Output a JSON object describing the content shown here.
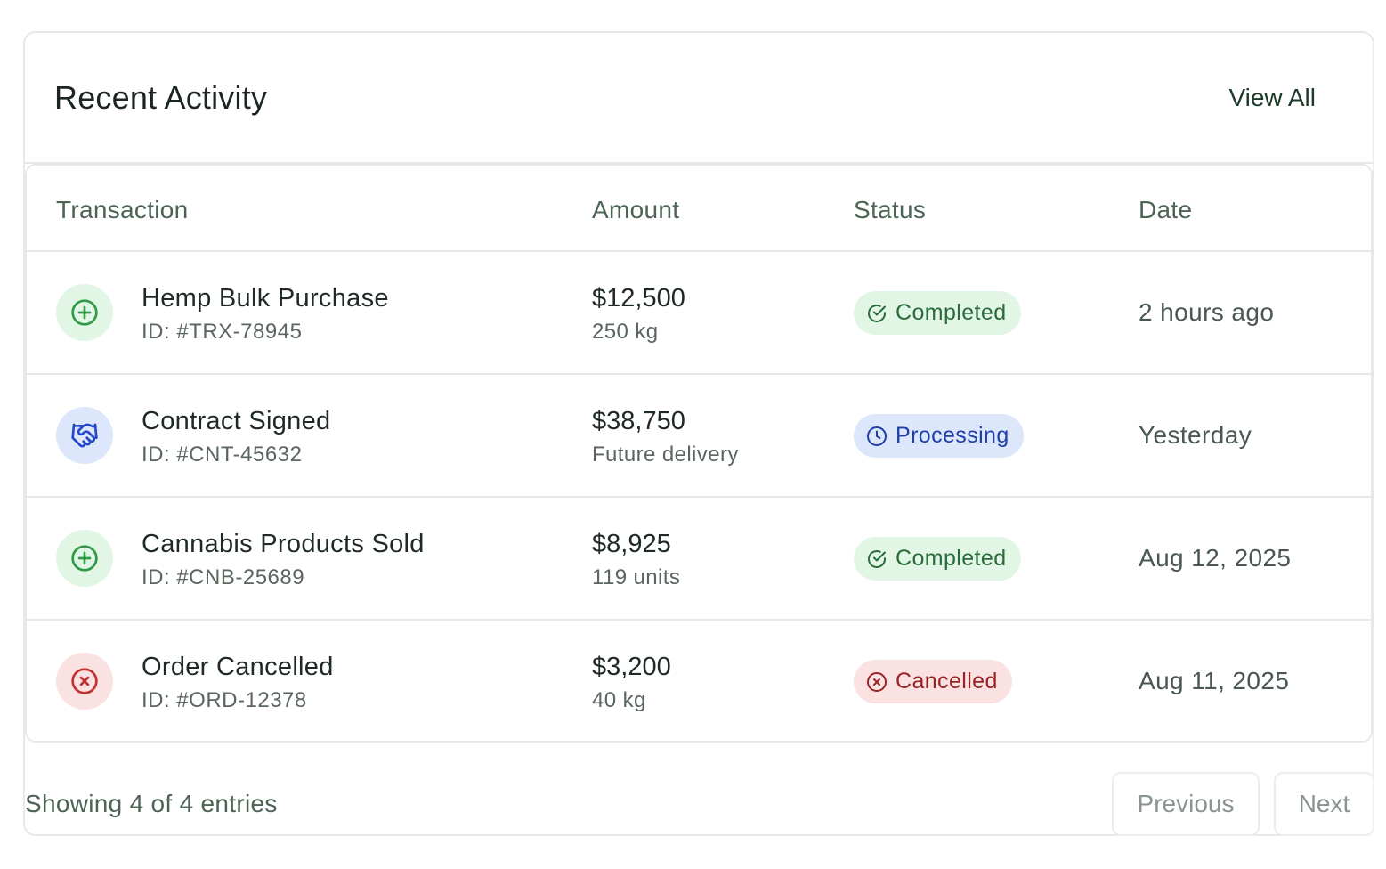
{
  "header": {
    "title": "Recent Activity",
    "view_all": "View All"
  },
  "table": {
    "columns": [
      "Transaction",
      "Amount",
      "Status",
      "Date"
    ],
    "rows": [
      {
        "icon": "plus-circle-icon",
        "icon_tone": "green",
        "name": "Hemp Bulk Purchase",
        "id": "ID: #TRX-78945",
        "amount": "$12,500",
        "amount_sub": "250 kg",
        "status": "Completed",
        "status_icon": "check-circle-icon",
        "date": "2 hours ago"
      },
      {
        "icon": "handshake-icon",
        "icon_tone": "blue",
        "name": "Contract Signed",
        "id": "ID: #CNT-45632",
        "amount": "$38,750",
        "amount_sub": "Future delivery",
        "status": "Processing",
        "status_icon": "clock-icon",
        "date": "Yesterday"
      },
      {
        "icon": "plus-circle-icon",
        "icon_tone": "green",
        "name": "Cannabis Products Sold",
        "id": "ID: #CNB-25689",
        "amount": "$8,925",
        "amount_sub": "119 units",
        "status": "Completed",
        "status_icon": "check-circle-icon",
        "date": "Aug 12, 2025"
      },
      {
        "icon": "x-circle-icon",
        "icon_tone": "red",
        "name": "Order Cancelled",
        "id": "ID: #ORD-12378",
        "amount": "$3,200",
        "amount_sub": "40 kg",
        "status": "Cancelled",
        "status_icon": "x-circle-icon",
        "date": "Aug 11, 2025"
      }
    ]
  },
  "footer": {
    "summary": "Showing 4 of 4 entries",
    "previous": "Previous",
    "next": "Next"
  },
  "colors": {
    "green": "#2f9a45",
    "blue": "#2448c9",
    "red": "#c53030"
  }
}
